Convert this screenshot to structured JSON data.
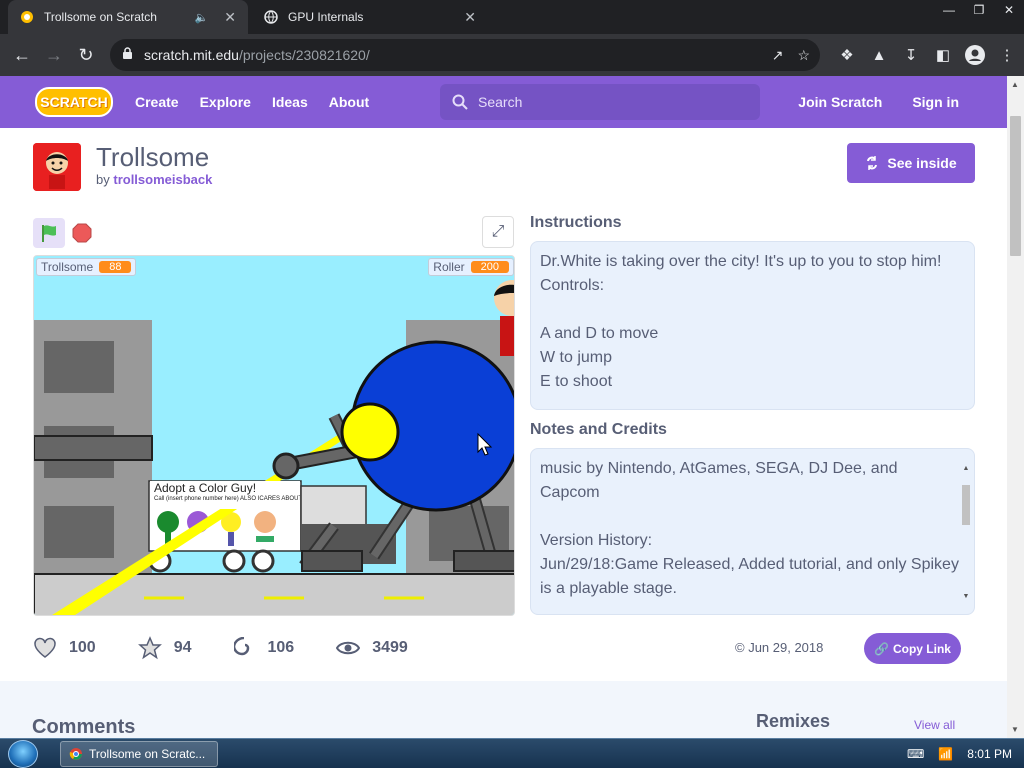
{
  "browser": {
    "tabs": [
      {
        "title": "Trollsome on Scratch",
        "active": true
      },
      {
        "title": "GPU Internals",
        "active": false
      }
    ],
    "url_host": "scratch.mit.edu",
    "url_path": "/projects/230821620/"
  },
  "nav": {
    "logo": "SCRATCH",
    "links": [
      "Create",
      "Explore",
      "Ideas",
      "About"
    ],
    "search_placeholder": "Search",
    "join": "Join Scratch",
    "signin": "Sign in",
    "color": "#855cd6"
  },
  "project": {
    "title": "Trollsome",
    "by_prefix": "by",
    "author": "trollsomeisback",
    "see_inside": "See inside",
    "stage": {
      "monitor_left_label": "Trollsome",
      "monitor_left_value": "88",
      "monitor_right_label": "Roller",
      "monitor_right_value": "200",
      "sign_title": "Adopt a Color Guy!",
      "sign_subtitle": "Call (insert phone number here) ALSO ICARES ABOUT YOU"
    },
    "instructions_heading": "Instructions",
    "instructions": [
      "Dr.White is taking over the city! It's up to you to stop him!",
      "Controls:",
      "",
      "A and D to move",
      "W to jump",
      "E to shoot"
    ],
    "notes_heading": "Notes and Credits",
    "notes": [
      "music by Nintendo, AtGames, SEGA, DJ Dee, and",
      "Capcom",
      "",
      "Version History:",
      "Jun/29/18:Game Released, Added tutorial, and only Spikey",
      "is a playable stage."
    ],
    "stats": {
      "loves": "100",
      "favorites": "94",
      "remixes": "106",
      "views": "3499"
    },
    "date": "© Jun 29, 2018",
    "copy_link": "Copy Link"
  },
  "lower": {
    "comments": "Comments",
    "remixes": "Remixes",
    "view_all": "View all"
  },
  "taskbar": {
    "item": "Trollsome on Scratc...",
    "time": "8:01 PM"
  }
}
